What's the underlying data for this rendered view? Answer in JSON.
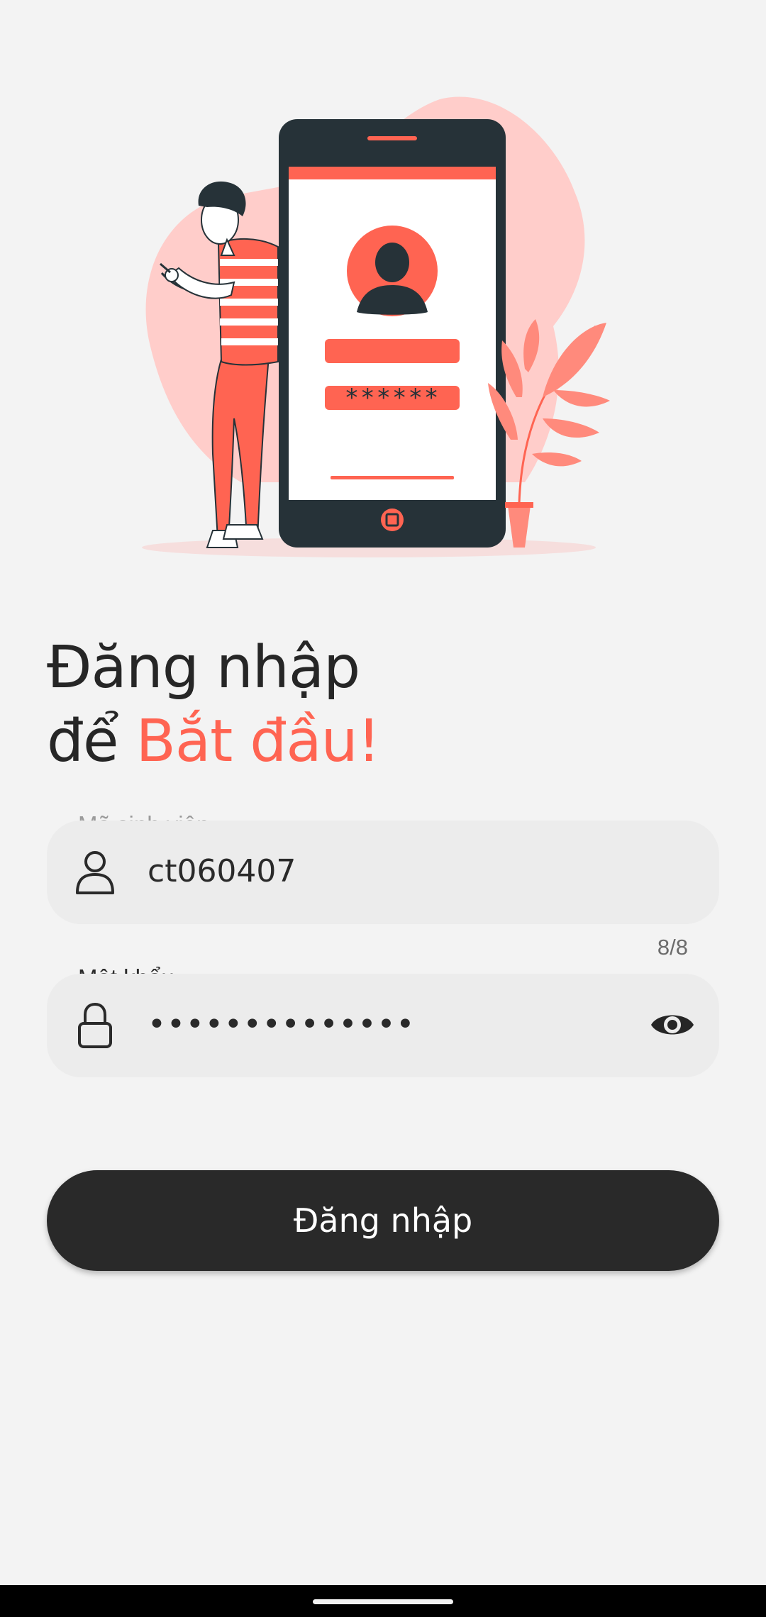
{
  "colors": {
    "accent": "#ff6452",
    "dark": "#262626",
    "field_bg": "#ececec",
    "background": "#f3f3f3"
  },
  "hero": {
    "phone_password_mask": "******"
  },
  "title": {
    "line1": "Đăng nhập",
    "line2_prefix": "để",
    "line2_accent": "Bắt đầu!"
  },
  "student_id": {
    "label": "Mã sinh viên",
    "value": "ct060407",
    "icon": "person-icon",
    "counter": "8/8"
  },
  "password": {
    "label": "Mật khẩu",
    "value": "••••••••••••••",
    "icon": "lock-icon",
    "toggle_icon": "eye-icon"
  },
  "login_button": {
    "label": "Đăng nhập"
  }
}
